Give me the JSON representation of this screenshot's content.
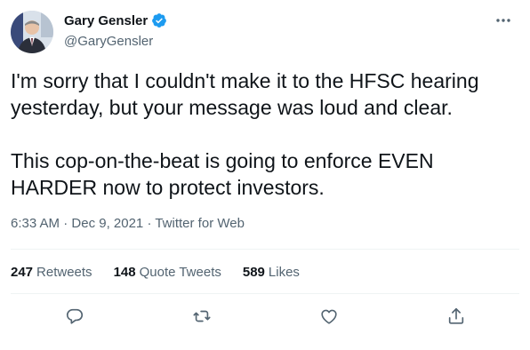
{
  "author": {
    "display_name": "Gary Gensler",
    "handle": "@GaryGensler",
    "verified": true,
    "verified_color": "#1d9bf0"
  },
  "tweet": {
    "paragraphs": [
      "I'm sorry that I couldn't make it to the HFSC hearing yesterday, but your message was loud and clear.",
      "This cop-on-the-beat is going to enforce EVEN HARDER now to protect investors."
    ]
  },
  "meta": {
    "time": "6:33 AM",
    "separator": " · ",
    "date": "Dec 9, 2021",
    "source": "Twitter for Web"
  },
  "stats": {
    "retweets_count": "247",
    "retweets_label": "Retweets",
    "quotes_count": "148",
    "quotes_label": "Quote Tweets",
    "likes_count": "589",
    "likes_label": "Likes"
  },
  "icons": {
    "more": "more-horizontal-icon",
    "reply": "reply-icon",
    "retweet": "retweet-icon",
    "like": "heart-icon",
    "share": "share-icon"
  },
  "colors": {
    "text": "#0f1419",
    "secondary": "#536471",
    "divider": "#eff3f4"
  }
}
